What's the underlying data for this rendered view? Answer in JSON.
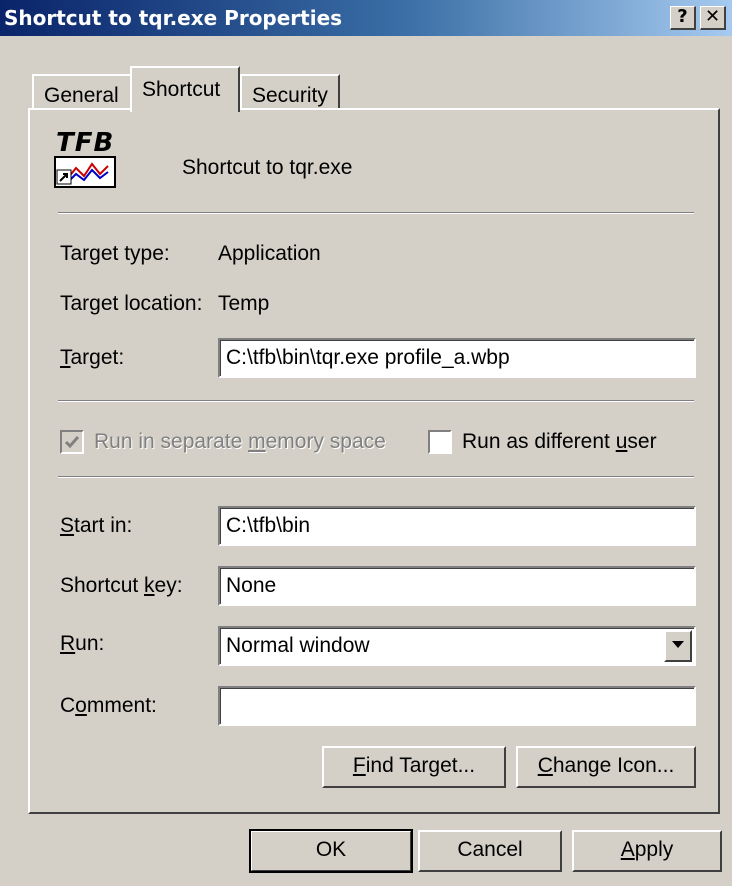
{
  "window": {
    "title": "Shortcut to tqr.exe Properties",
    "help_button": "?",
    "close_button": "✕"
  },
  "tabs": [
    {
      "label": "General"
    },
    {
      "label": "Shortcut",
      "selected": true
    },
    {
      "label": "Security"
    }
  ],
  "header": {
    "icon": "tfb-app-shortcut-icon",
    "icon_text": "TFB",
    "name": "Shortcut to tqr.exe"
  },
  "info": {
    "target_type_label": "Target type:",
    "target_type_value": "Application",
    "target_location_label": "Target location:",
    "target_location_value": "Temp"
  },
  "target": {
    "label_u": "T",
    "label_rest": "arget:",
    "value": "C:\\tfb\\bin\\tqr.exe profile_a.wbp"
  },
  "options": {
    "separate_memory": {
      "label_pre": "Run in separate ",
      "label_u": "m",
      "label_post": "emory space",
      "checked": true,
      "disabled": true
    },
    "different_user": {
      "label_pre": "Run as different ",
      "label_u": "u",
      "label_post": "ser",
      "checked": false
    }
  },
  "start_in": {
    "label_u": "S",
    "label_rest": "tart in:",
    "value": "C:\\tfb\\bin"
  },
  "shortcut_key": {
    "label_pre": "Shortcut ",
    "label_u": "k",
    "label_post": "ey:",
    "value": "None"
  },
  "run": {
    "label_u": "R",
    "label_rest": "un:",
    "value": "Normal window"
  },
  "comment": {
    "label_pre": "C",
    "label_u": "o",
    "label_post": "mment:",
    "value": ""
  },
  "panel_buttons": {
    "find_target": {
      "u": "F",
      "rest": "ind Target..."
    },
    "change_icon": {
      "u": "C",
      "rest": "hange Icon..."
    }
  },
  "dialog_buttons": {
    "ok": "OK",
    "cancel": "Cancel",
    "apply_u": "A",
    "apply_rest": "pply"
  },
  "colors": {
    "titlebar_start": "#0a246a",
    "titlebar_end": "#a6caf0",
    "face": "#d4d0c8"
  }
}
